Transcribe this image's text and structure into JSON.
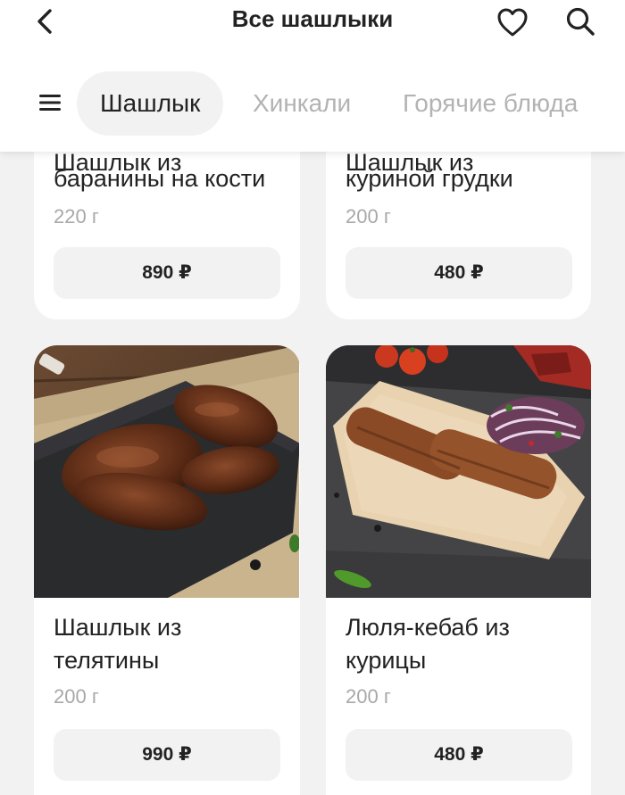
{
  "header": {
    "title": "Все шашлыки",
    "icons": [
      "back-icon",
      "heart-icon",
      "search-icon",
      "menu-icon"
    ]
  },
  "tabs": [
    {
      "label": "Шашлык",
      "active": true
    },
    {
      "label": "Хинкали",
      "active": false
    },
    {
      "label": "Горячие блюда",
      "active": false
    }
  ],
  "products": [
    {
      "name_partial": "Шашлык из",
      "name_line2": "баранины на кости",
      "weight": "220 г",
      "price": "890 ₽"
    },
    {
      "name_partial": "Шашлык из",
      "name_line2": "куриной грудки",
      "weight": "200 г",
      "price": "480 ₽"
    },
    {
      "name_line1": "Шашлык из",
      "name_line2": "телятины",
      "weight": "200 г",
      "price": "990 ₽"
    },
    {
      "name_line1": "Люля-кебаб из",
      "name_line2": "курицы",
      "weight": "200 г",
      "price": "480 ₽"
    }
  ],
  "colors": {
    "background": "#f2f2f2",
    "card": "#ffffff",
    "active_tab_bg": "#f2f2f2",
    "inactive_tab_text": "#b3b3b3",
    "text": "#222222",
    "muted": "#a8a8a8"
  }
}
